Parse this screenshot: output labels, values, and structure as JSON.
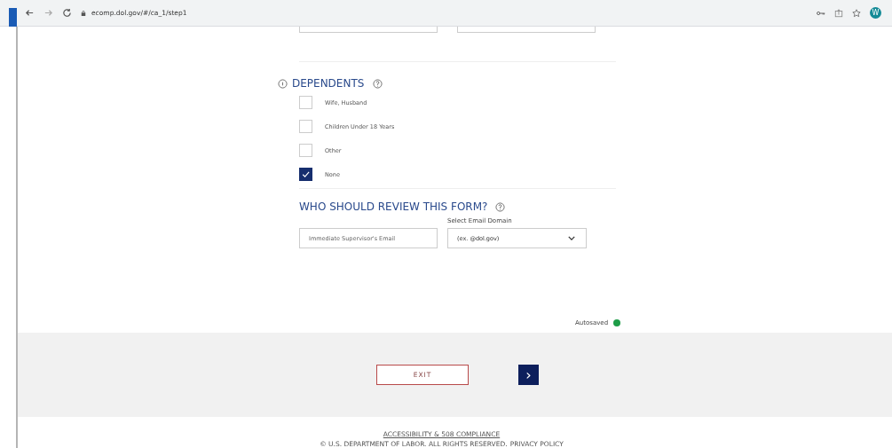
{
  "browser": {
    "url": "ecomp.dol.gov/#/ca_1/step1",
    "profile_initial": "W"
  },
  "dependents": {
    "title": "DEPENDENTS",
    "options": [
      {
        "label": "Wife, Husband",
        "checked": false
      },
      {
        "label": "Children Under 18 Years",
        "checked": false
      },
      {
        "label": "Other",
        "checked": false
      },
      {
        "label": "None",
        "checked": true
      }
    ]
  },
  "reviewer": {
    "title": "WHO SHOULD REVIEW THIS FORM?",
    "email": {
      "placeholder": "Immediate Supervisor's Email"
    },
    "domain": {
      "label": "Select Email Domain",
      "value": "(ex. @dol.gov)"
    }
  },
  "status": {
    "text": "Autosaved"
  },
  "actions": {
    "exit": "EXIT",
    "next": "›"
  },
  "footer": {
    "accessibility": "ACCESSIBILITY & 508 COMPLIANCE",
    "copyright": "© U.S. DEPARTMENT OF LABOR. ALL RIGHTS RESERVED.",
    "privacy": "PRIVACY POLICY"
  }
}
